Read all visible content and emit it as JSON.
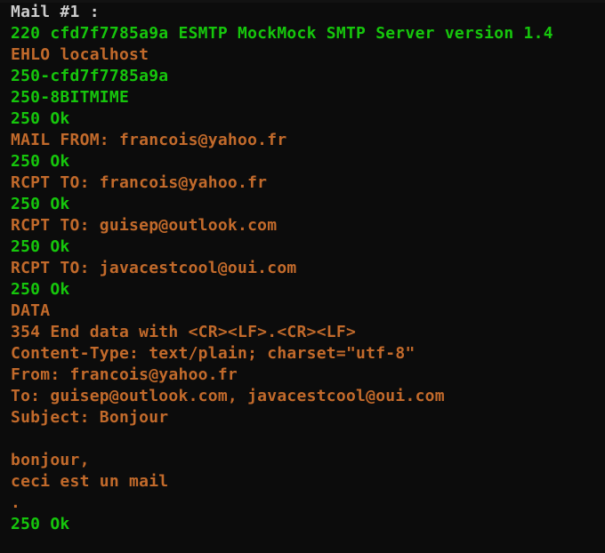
{
  "colors": {
    "background": "#0c0c0c",
    "white": "#cccccc",
    "green": "#16c60c",
    "orange": "#c26a2b"
  },
  "lines": [
    {
      "text": "Mail #1 :",
      "color": "white"
    },
    {
      "text": "220 cfd7f7785a9a ESMTP MockMock SMTP Server version 1.4",
      "color": "green"
    },
    {
      "text": "EHLO localhost",
      "color": "orange"
    },
    {
      "text": "250-cfd7f7785a9a",
      "color": "green"
    },
    {
      "text": "250-8BITMIME",
      "color": "green"
    },
    {
      "text": "250 Ok",
      "color": "green"
    },
    {
      "text": "MAIL FROM: francois@yahoo.fr",
      "color": "orange"
    },
    {
      "text": "250 Ok",
      "color": "green"
    },
    {
      "text": "RCPT TO: francois@yahoo.fr",
      "color": "orange"
    },
    {
      "text": "250 Ok",
      "color": "green"
    },
    {
      "text": "RCPT TO: guisep@outlook.com",
      "color": "orange"
    },
    {
      "text": "250 Ok",
      "color": "green"
    },
    {
      "text": "RCPT TO: javacestcool@oui.com",
      "color": "orange"
    },
    {
      "text": "250 Ok",
      "color": "green"
    },
    {
      "text": "DATA",
      "color": "orange"
    },
    {
      "text": "354 End data with <CR><LF>.<CR><LF>",
      "color": "orange"
    },
    {
      "text": "Content-Type: text/plain; charset=\"utf-8\"",
      "color": "orange"
    },
    {
      "text": "From: francois@yahoo.fr",
      "color": "orange"
    },
    {
      "text": "To: guisep@outlook.com, javacestcool@oui.com",
      "color": "orange"
    },
    {
      "text": "Subject: Bonjour",
      "color": "orange"
    },
    {
      "text": "",
      "color": "orange"
    },
    {
      "text": "bonjour,",
      "color": "orange"
    },
    {
      "text": "ceci est un mail",
      "color": "orange"
    },
    {
      "text": ".",
      "color": "orange"
    },
    {
      "text": "250 Ok",
      "color": "green"
    }
  ]
}
